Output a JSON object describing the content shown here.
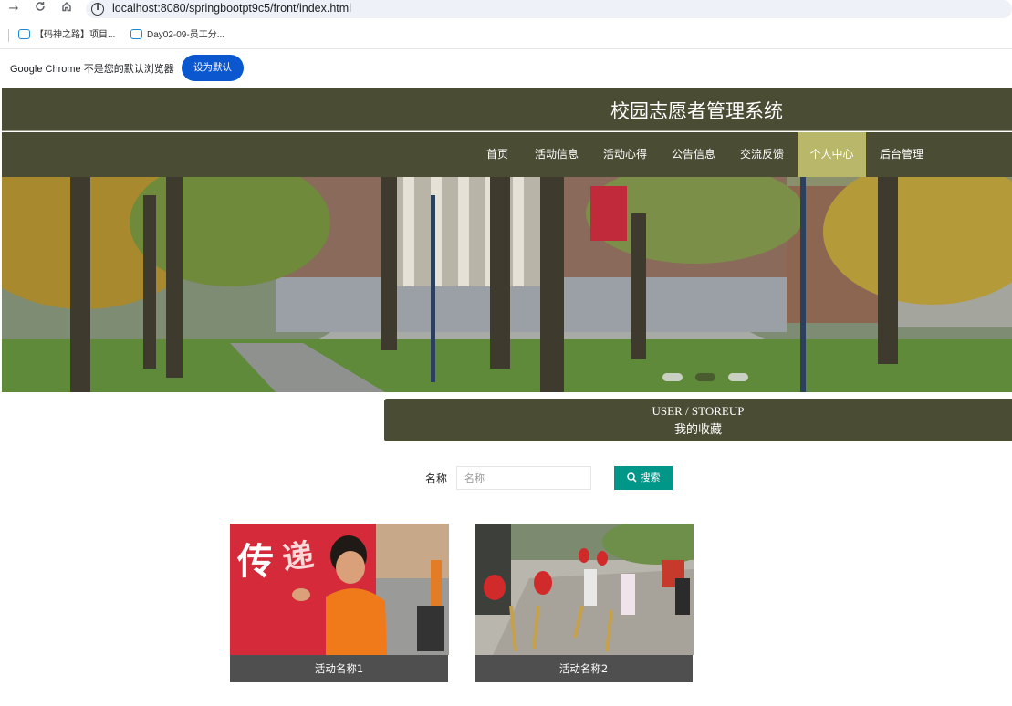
{
  "browser": {
    "url": "localhost:8080/springbootpt9c5/front/index.html",
    "bookmarks": [
      "【码神之路】项目...",
      "Day02-09-员工分..."
    ],
    "infobar": {
      "message": "Google Chrome 不是您的默认浏览器",
      "button": "设为默认"
    }
  },
  "site": {
    "title": "校园志愿者管理系统",
    "nav": [
      "首页",
      "活动信息",
      "活动心得",
      "公告信息",
      "交流反馈",
      "个人中心",
      "后台管理"
    ],
    "active_nav_index": 5,
    "page_title_en": "USER / STOREUP",
    "page_title_cn": "我的收藏",
    "search": {
      "label": "名称",
      "placeholder": "名称",
      "button": "搜索"
    },
    "cards": [
      {
        "caption": "活动名称1"
      },
      {
        "caption": "活动名称2"
      }
    ],
    "carousel_slide_count": 3,
    "carousel_active_index": 1
  },
  "colors": {
    "header": "#4b4c34",
    "nav_active": "#b8b76a",
    "search_button": "#009688",
    "chrome_button": "#0b57d0"
  }
}
